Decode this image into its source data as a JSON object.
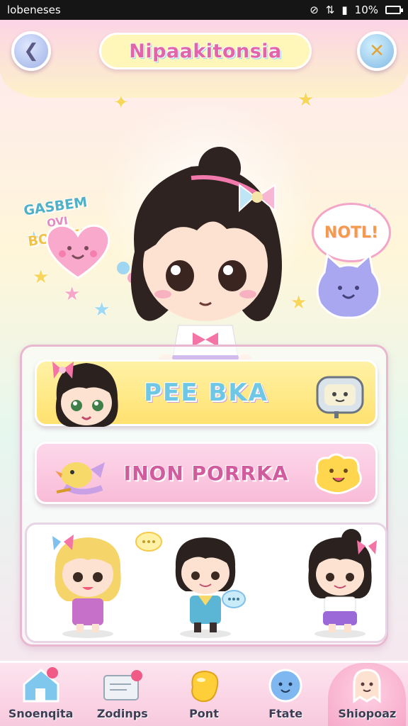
{
  "status_bar": {
    "carrier": "lobeneses",
    "battery": "10%"
  },
  "header": {
    "title": "Nipaakitonsia",
    "back_icon": "back-arrow-icon",
    "close_icon": "close-x-icon"
  },
  "hero": {
    "left_bubble": [
      "GASBEM",
      "OVI",
      "BOOREJR"
    ],
    "right_bubble": "NOTL!"
  },
  "options": [
    {
      "label": "PEE BKA",
      "color": "#ffe16f"
    },
    {
      "label": "INON PORRKA",
      "color": "#f9bcd8"
    }
  ],
  "nav": {
    "items": [
      {
        "label": "Snoenqita",
        "icon": "home-icon"
      },
      {
        "label": "Zodinps",
        "icon": "ticket-icon"
      },
      {
        "label": "Pont",
        "icon": "bean-icon"
      },
      {
        "label": "Ftate",
        "icon": "bubble-face-icon"
      },
      {
        "label": "Shiopoaz",
        "icon": "ghost-face-icon"
      }
    ],
    "active_index": 4
  }
}
